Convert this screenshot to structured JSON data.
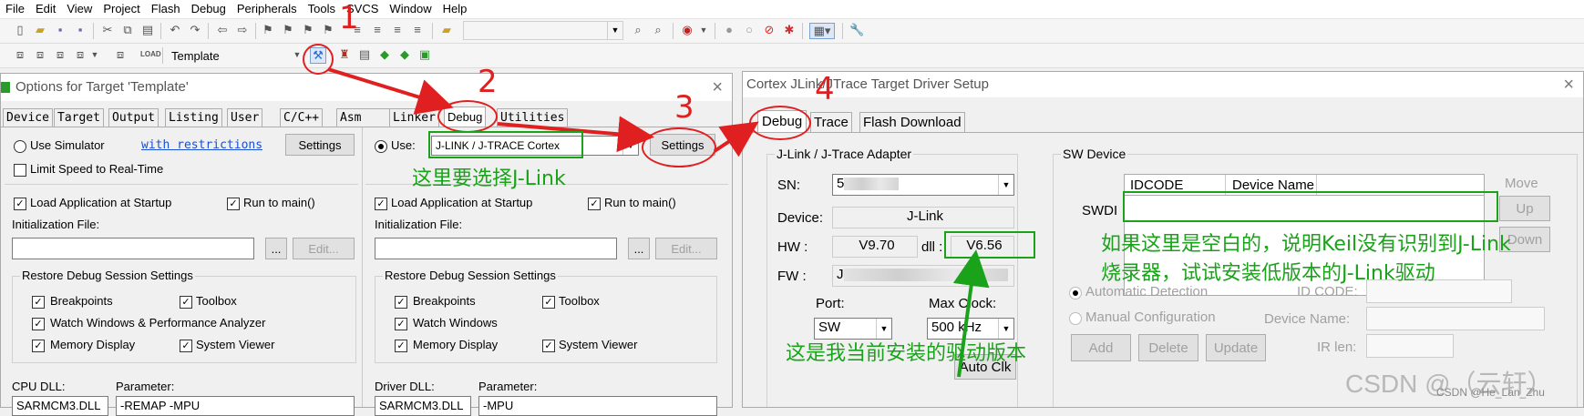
{
  "menu": [
    "File",
    "Edit",
    "View",
    "Project",
    "Flash",
    "Debug",
    "Peripherals",
    "Tools",
    "SVCS",
    "Window",
    "Help"
  ],
  "toolbar2": {
    "target_name": "Template"
  },
  "options_dialog": {
    "title": "Options for Target 'Template'",
    "close": "×",
    "tabs": [
      "Device",
      "Target",
      "Output",
      "Listing",
      "User",
      "C/C++",
      "Asm",
      "Linker",
      "Debug",
      "Utilities"
    ],
    "left": {
      "use_simulator": "Use Simulator",
      "with_restrictions": "with restrictions",
      "settings": "Settings",
      "limit_speed": "Limit Speed to Real-Time",
      "load_app": "Load Application at Startup",
      "run_to_main": "Run to main()",
      "init_file": "Initialization File:",
      "browse": "...",
      "edit": "Edit...",
      "restore_title": "Restore Debug Session Settings",
      "breakpoints": "Breakpoints",
      "toolbox": "Toolbox",
      "watch": "Watch Windows & Performance Analyzer",
      "memory": "Memory Display",
      "system_viewer": "System Viewer",
      "cpu_dll": "CPU DLL:",
      "parameter": "Parameter:",
      "cpu_dll_value": "SARMCM3.DLL",
      "param_value": "-REMAP -MPU"
    },
    "right": {
      "use": "Use:",
      "driver": "J-LINK / J-TRACE Cortex",
      "settings": "Settings",
      "load_app": "Load Application at Startup",
      "run_to_main": "Run to main()",
      "init_file": "Initialization File:",
      "browse": "...",
      "edit": "Edit...",
      "restore_title": "Restore Debug Session Settings",
      "breakpoints": "Breakpoints",
      "toolbox": "Toolbox",
      "watch": "Watch Windows",
      "memory": "Memory Display",
      "system_viewer": "System Viewer",
      "driver_dll": "Driver DLL:",
      "parameter": "Parameter:",
      "driver_dll_value": "SARMCM3.DLL",
      "param_value": "-MPU"
    }
  },
  "driver_dialog": {
    "title": "Cortex JLink/JTrace Target Driver Setup",
    "close": "×",
    "tabs": [
      "Debug",
      "Trace",
      "Flash Download"
    ],
    "adapter": {
      "title": "J-Link / J-Trace Adapter",
      "sn_label": "SN:",
      "sn_value": "5",
      "device_label": "Device:",
      "device_value": "J-Link",
      "hw_label": "HW :",
      "hw_value": "V9.70",
      "dll_label": "dll :",
      "dll_value": "V6.56",
      "fw_label": "FW :",
      "fw_value": "J",
      "port_label": "Port:",
      "port_value": "SW",
      "maxclock_label": "Max Clock:",
      "maxclock_value": "500 kHz",
      "autoclk": "Auto Clk"
    },
    "swdevice": {
      "title": "SW Device",
      "col_idcode": "IDCODE",
      "col_devname": "Device Name",
      "swdi": "SWDI",
      "move": "Move",
      "up": "Up",
      "down": "Down",
      "auto_detect": "Automatic Detection",
      "manual_config": "Manual Configuration",
      "id_code": "ID CODE:",
      "device_name": "Device Name:",
      "ir_len": "IR len:",
      "add": "Add",
      "delete": "Delete",
      "update": "Update"
    }
  },
  "annotations": {
    "step1": "1",
    "step2": "2",
    "step3": "3",
    "step4": "4",
    "select_jlink": "这里要选择J-Link",
    "empty_note_line1": "如果这里是空白的，说明Keil没有识别到J-Link",
    "empty_note_line2": "烧录器，试试安装低版本的J-Link驱动",
    "driver_version_note": "这是我当前安装的驱动版本"
  },
  "watermark": {
    "big": "CSDN @（云轩）",
    "small": "CSDN @He_Lan_Zhu"
  },
  "colors": {
    "annotation_red": "#e02020",
    "annotation_green": "#1aa31a",
    "link_blue": "#1a4fd1"
  }
}
